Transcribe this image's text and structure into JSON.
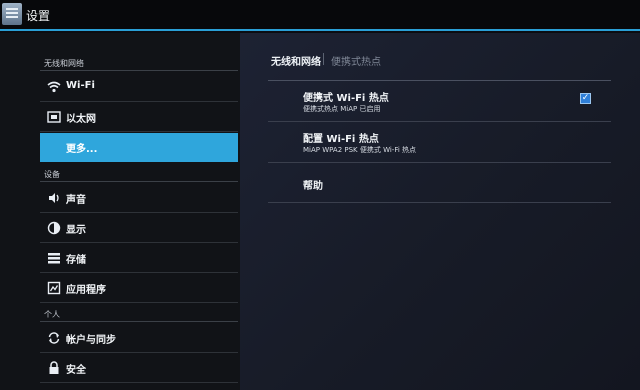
{
  "titlebar": {
    "title": "设置",
    "icon": "settings-icon"
  },
  "left": {
    "sections": [
      {
        "header": "无线和网络",
        "items": [
          {
            "label": "Wi-Fi",
            "icon": "wifi-icon",
            "selected": false
          },
          {
            "label": "以太网",
            "icon": "ethernet-icon",
            "selected": false
          },
          {
            "label": "更多...",
            "icon": "",
            "selected": true
          }
        ]
      },
      {
        "header": "设备",
        "items": [
          {
            "label": "声音",
            "icon": "sound-icon",
            "selected": false
          },
          {
            "label": "显示",
            "icon": "display-icon",
            "selected": false
          },
          {
            "label": "存储",
            "icon": "storage-icon",
            "selected": false
          },
          {
            "label": "应用程序",
            "icon": "apps-icon",
            "selected": false
          }
        ]
      },
      {
        "header": "个人",
        "items": [
          {
            "label": "帐户与同步",
            "icon": "sync-icon",
            "selected": false
          },
          {
            "label": "安全",
            "icon": "lock-icon",
            "selected": false
          }
        ]
      }
    ]
  },
  "right": {
    "breadcrumb": {
      "parent": "无线和网络",
      "current": "便携式热点"
    },
    "rows": [
      {
        "title": "便携式 Wi-Fi 热点",
        "subtitle": "便携式热点 MiAP 已启用",
        "checked": true
      },
      {
        "title": "配置 Wi-Fi 热点",
        "subtitle": "MiAP WPA2 PSK 便携式 Wi-Fi 热点"
      },
      {
        "title": "帮助",
        "subtitle": ""
      }
    ]
  },
  "colors": {
    "accent": "#2fa6dc",
    "background": "#111317"
  }
}
